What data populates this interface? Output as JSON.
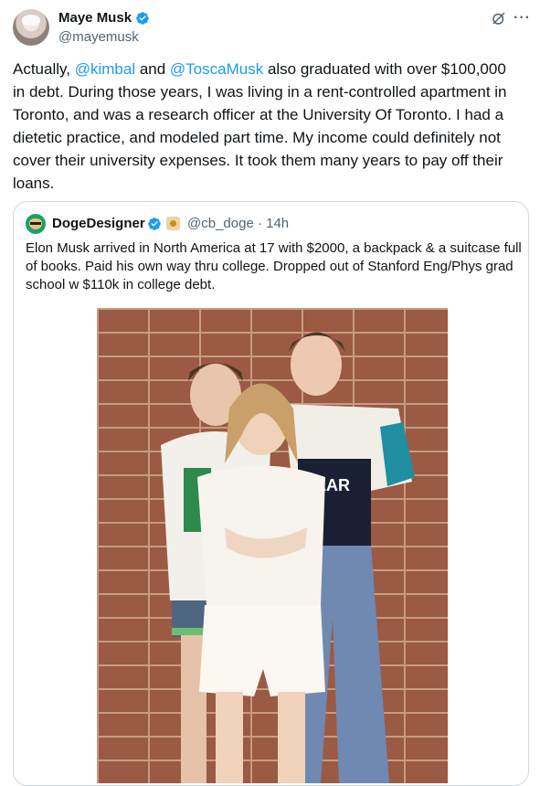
{
  "tweet": {
    "author_name": "Maye Musk",
    "handle": "@mayemusk",
    "text_prefix": "Actually, ",
    "mention_1": "@kimbal",
    "text_mid": " and ",
    "mention_2": "@ToscaMusk",
    "text_suffix": " also graduated with over $100,000\nin debt. During those years, I was living in a rent-controlled apartment in\nToronto, and was a research officer at the University Of Toronto. I had a\ndietetic practice, and modeled part time. My income could definitely not\ncover their university expenses. It took them many years to pay off their\nloans."
  },
  "quoted_tweet": {
    "author_name": "DogeDesigner",
    "handle_time": "@cb_doge · 14h",
    "text": "Elon Musk arrived in North America at 17 with $2000, a backpack & a suitcase full of books. Paid his own way thru college. Dropped out of Stanford Eng/Phys grad school w $110k in college debt.",
    "photo_shirt_text": "BEAR"
  },
  "icons": {
    "verified": "verified-badge-icon",
    "grok": "grok-icon",
    "more": "more-icon",
    "affiliate": "affiliate-badge-icon"
  },
  "colors": {
    "accent": "#1d9bf0",
    "text": "#0f1419",
    "muted": "#536471",
    "border": "#cfd9de"
  }
}
